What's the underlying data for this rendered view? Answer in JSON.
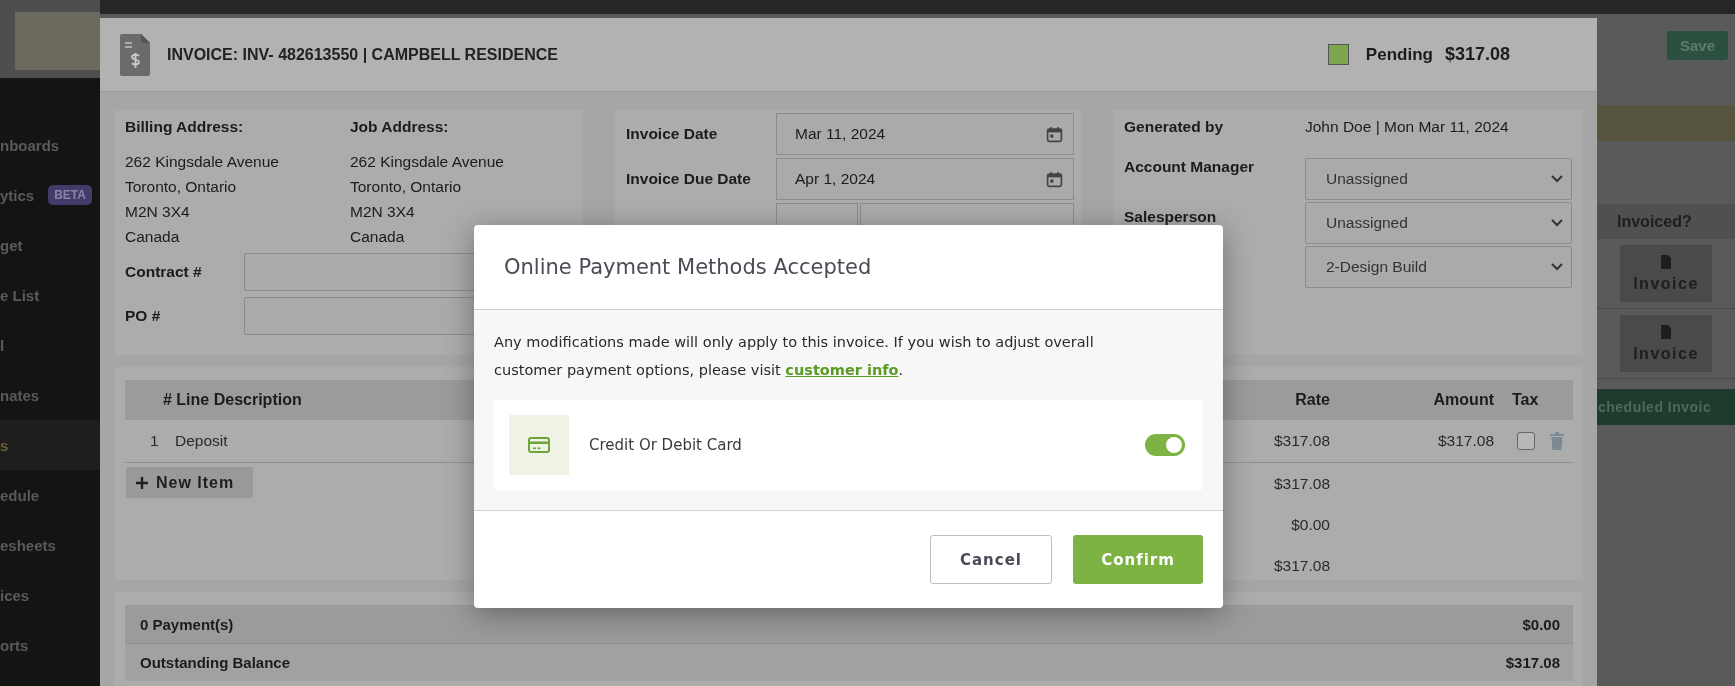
{
  "sidebar": {
    "items": [
      {
        "label": "nboards",
        "selected": false
      },
      {
        "label": "ytics",
        "badge": "BETA",
        "selected": false
      },
      {
        "label": "get",
        "selected": false
      },
      {
        "label": "e List",
        "selected": false
      },
      {
        "label": "l",
        "selected": false
      },
      {
        "label": "nates",
        "selected": false
      },
      {
        "label": "s",
        "selected": true
      },
      {
        "label": "edule",
        "selected": false
      },
      {
        "label": "esheets",
        "selected": false
      },
      {
        "label": "ices",
        "selected": false
      },
      {
        "label": "orts",
        "selected": false
      }
    ]
  },
  "background_panel": {
    "save_button": "Save",
    "invoiced_header": "Invoiced?",
    "invoice_buttons": [
      "Invoice",
      "Invoice"
    ],
    "scheduled_bar": "cheduled Invoic"
  },
  "invoice": {
    "title": "INVOICE: INV- 482613550 | CAMPBELL RESIDENCE",
    "status": {
      "label": "Pending",
      "color": "#7ea450"
    },
    "total": "$317.08",
    "addresses": [
      {
        "heading": "Billing Address:",
        "lines": [
          "262 Kingsdale Avenue",
          "Toronto, Ontario",
          "M2N 3X4",
          "Canada"
        ]
      },
      {
        "heading": "Job Address:",
        "lines": [
          "262 Kingsdale Avenue",
          "Toronto, Ontario",
          "M2N 3X4",
          "Canada"
        ]
      }
    ],
    "reference_fields": [
      {
        "label": "Contract #"
      },
      {
        "label": "PO #"
      }
    ],
    "dates": [
      {
        "label": "Invoice Date",
        "value": "Mar 11, 2024"
      },
      {
        "label": "Invoice Due Date",
        "value": "Apr 1, 2024"
      }
    ],
    "generated": {
      "label": "Generated by",
      "value": "John Doe | Mon Mar 11, 2024"
    },
    "assignments": [
      {
        "label": "Account Manager",
        "value": "Unassigned"
      },
      {
        "label": "Salesperson",
        "value": "Unassigned"
      },
      {
        "value": "2-Design Build"
      }
    ],
    "line_items": {
      "columns": [
        "# Line Description",
        "Rate",
        "Amount",
        "Tax"
      ],
      "rows": [
        {
          "number": "1",
          "description": "Deposit",
          "rate": "$317.08",
          "amount": "$317.08",
          "taxed": false
        }
      ],
      "new_item_button": "New Item",
      "totals": [
        "$317.08",
        "$0.00",
        "$317.08"
      ]
    },
    "payments": [
      {
        "label": "0 Payment(s)",
        "amount": "$0.00"
      },
      {
        "label": "Outstanding Balance",
        "amount": "$317.08"
      }
    ]
  },
  "modal": {
    "title": "Online Payment Methods Accepted",
    "message": "Any modifications made will only apply to this invoice. If you wish to adjust overall customer payment options, please visit ",
    "link": "customer info",
    "message_end": ".",
    "methods": [
      {
        "label": "Credit Or Debit Card",
        "on": true
      }
    ],
    "buttons": [
      {
        "label": "Cancel",
        "kind": "secondary"
      },
      {
        "label": "Confirm",
        "kind": "primary"
      }
    ]
  }
}
